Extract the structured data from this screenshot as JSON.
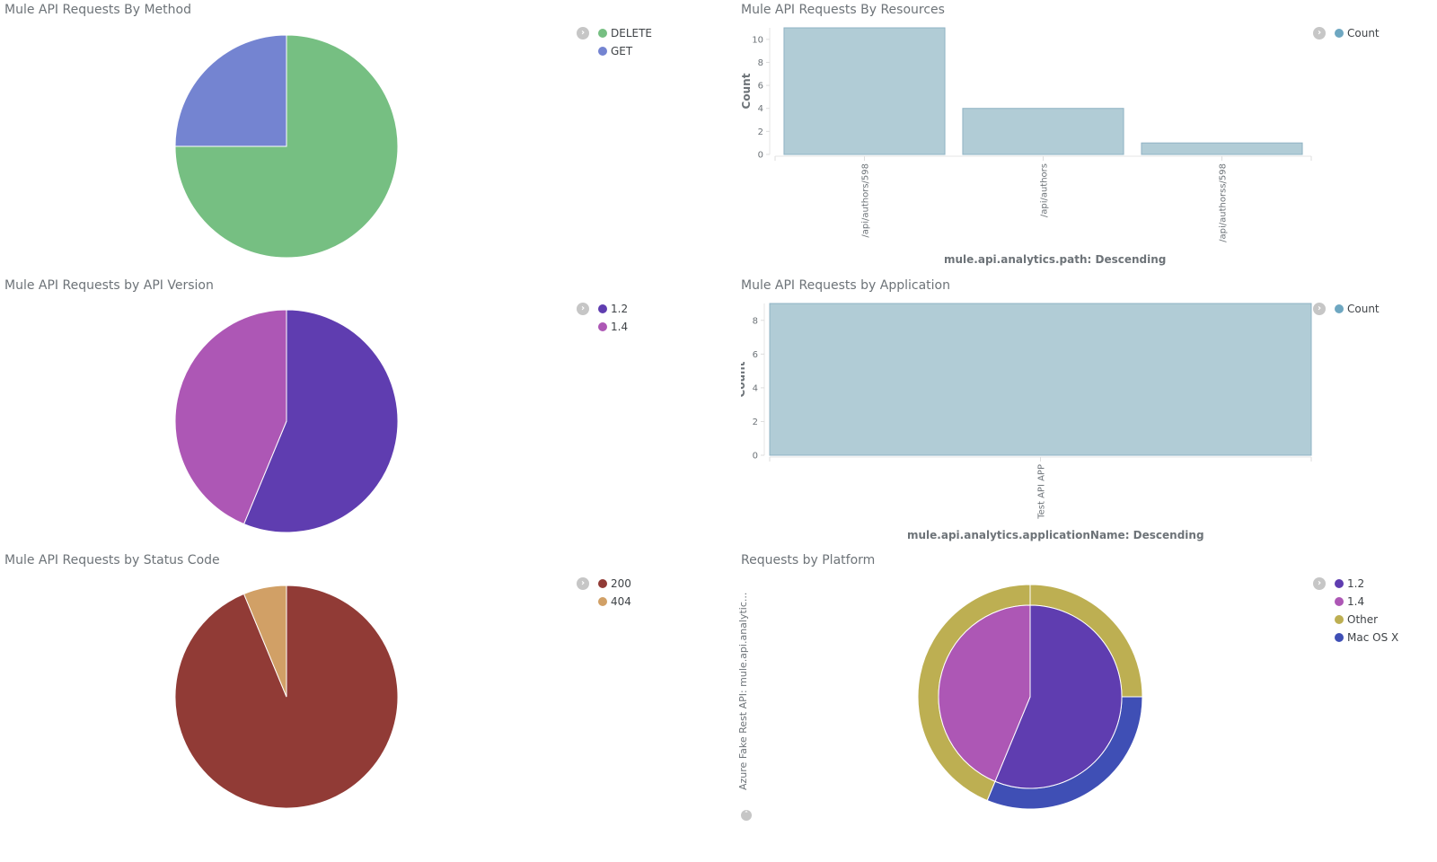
{
  "panels": [
    {
      "title": "Mule API Requests By Method"
    },
    {
      "title": "Mule API Requests By Resources"
    },
    {
      "title": "Mule API Requests by API Version"
    },
    {
      "title": "Mule API Requests by Application"
    },
    {
      "title": "Mule API Requests by Status Code"
    },
    {
      "title": "Requests by Platform",
      "side_label": "Azure Fake Rest API: mule.api.analytic..."
    }
  ],
  "icons": {
    "legend_toggle": "chevron-right-circle-icon",
    "collapse": "chevron-up-circle-icon"
  },
  "chart_data": [
    {
      "type": "pie",
      "title": "Mule API Requests By Method",
      "labels": [
        "DELETE",
        "GET"
      ],
      "values": [
        12,
        4
      ],
      "colors": [
        "#76bf82",
        "#7484d1"
      ],
      "legend": [
        "DELETE",
        "GET"
      ],
      "legend_position": "top-right"
    },
    {
      "type": "bar",
      "title": "Mule API Requests By Resources",
      "categories": [
        "/api/authors/598",
        "/api/authors",
        "/api/authorss/598"
      ],
      "values": [
        11,
        4,
        1
      ],
      "ylabel": "Count",
      "xlabel": "mule.api.analytics.path: Descending",
      "yticks": [
        "0",
        "2",
        "4",
        "6",
        "8",
        "10"
      ],
      "ylim": [
        0,
        11
      ],
      "color": "#b1ccd6",
      "legend": [
        "Count"
      ],
      "legend_color": "#6ea7c1",
      "legend_position": "top-right"
    },
    {
      "type": "pie",
      "title": "Mule API Requests by API Version",
      "labels": [
        "1.2",
        "1.4"
      ],
      "values": [
        9,
        7
      ],
      "colors": [
        "#5f3db0",
        "#ad57b5"
      ],
      "legend": [
        "1.2",
        "1.4"
      ],
      "legend_position": "top-right"
    },
    {
      "type": "bar",
      "title": "Mule API Requests by Application",
      "categories": [
        "Test API APP"
      ],
      "values": [
        9
      ],
      "ylabel": "Count",
      "xlabel": "mule.api.analytics.applicationName: Descending",
      "yticks": [
        "0",
        "2",
        "4",
        "6",
        "8"
      ],
      "ylim": [
        0,
        9
      ],
      "color": "#b1ccd6",
      "legend": [
        "Count"
      ],
      "legend_color": "#6ea7c1",
      "legend_position": "top-right"
    },
    {
      "type": "pie",
      "title": "Mule API Requests by Status Code",
      "labels": [
        "200",
        "404"
      ],
      "values": [
        15,
        1
      ],
      "colors": [
        "#913b36",
        "#d1a066"
      ],
      "legend": [
        "200",
        "404"
      ],
      "legend_position": "top-right"
    },
    {
      "type": "pie",
      "title": "Requests by Platform",
      "inner": {
        "labels": [
          "1.2",
          "1.4"
        ],
        "values": [
          9,
          7
        ],
        "colors": [
          "#5f3db0",
          "#ad57b5"
        ]
      },
      "outer": {
        "labels": [
          "Other",
          "Mac OS X",
          "Other"
        ],
        "parents": [
          "1.2",
          "1.2",
          "1.4"
        ],
        "values": [
          4,
          5,
          7
        ],
        "colors": [
          "#bdaf52",
          "#3f4fb5",
          "#bdaf52"
        ]
      },
      "legend": [
        "1.2",
        "1.4",
        "Other",
        "Mac OS X"
      ],
      "legend_colors": [
        "#5f3db0",
        "#ad57b5",
        "#bdaf52",
        "#3f4fb5"
      ],
      "legend_position": "top-right"
    }
  ]
}
